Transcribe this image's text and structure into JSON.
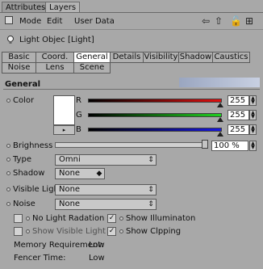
{
  "tabs": [
    {
      "label": "Attributes",
      "active": true
    },
    {
      "label": "Layers",
      "active": false
    }
  ],
  "menu": [
    {
      "label": "Mode"
    },
    {
      "label": "Edit"
    },
    {
      "label": "User Data"
    }
  ],
  "nav_icons": [
    "back-arrow-icon",
    "up-arrow-icon",
    "lock-icon",
    "new-panel-icon"
  ],
  "object": {
    "title": "Light Objec [Light]"
  },
  "subtabs": {
    "row1": [
      "Basic",
      "Coord.",
      "General",
      "Details",
      "Visibility",
      "Shadow",
      "Caustics"
    ],
    "row2": [
      "Noise",
      "Lens",
      "Scene"
    ],
    "active": "General"
  },
  "section": {
    "title": "General"
  },
  "color": {
    "label": "Color",
    "channels": [
      {
        "name": "R",
        "value": "255",
        "level": 1.0,
        "color": "#d01010"
      },
      {
        "name": "G",
        "value": "255",
        "level": 1.0,
        "color": "#10c010"
      },
      {
        "name": "B",
        "value": "255",
        "level": 1.0,
        "color": "#1010d0"
      }
    ]
  },
  "brightness": {
    "label": "Brighness",
    "value": "100 %",
    "level": 1.0
  },
  "type": {
    "label": "Type",
    "value": "Omni"
  },
  "shadow": {
    "label": "Shadow",
    "value": "None"
  },
  "visible_light": {
    "label": "Visible Light",
    "value": "None"
  },
  "noise": {
    "label": "Noise",
    "value": "None"
  },
  "checks": [
    {
      "label": "No Light Radation",
      "checked": false
    },
    {
      "label": "Show Illuminaton",
      "checked": true
    },
    {
      "label": "Show Visible Light",
      "checked": false
    },
    {
      "label": "Show Clpping",
      "checked": true
    }
  ],
  "info": {
    "memory_label": "Memory Requirement:",
    "memory_value": "Low",
    "render_label": "Fencer Time:",
    "render_value": "Low"
  }
}
